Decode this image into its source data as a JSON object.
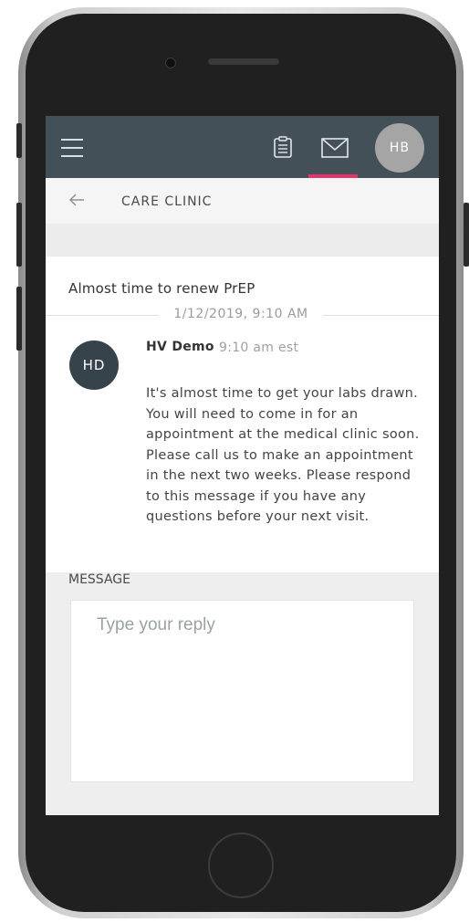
{
  "header": {
    "avatar_initials": "HB",
    "accent_color": "#e6336b",
    "bar_color": "#435058"
  },
  "subheader": {
    "title": "CARE CLINIC"
  },
  "message": {
    "subject": "Almost time to renew PrEP",
    "date": "1/12/2019, 9:10 AM",
    "sender_initials": "HD",
    "sender_name": "HV Demo",
    "sent_time": "9:10 am est",
    "body": "It's almost time to get your labs drawn. You will need to come in for an appointment at the medical clinic soon. Please call us to make an appointment in the next two weeks. Please respond to this message if you have any questions before your next visit."
  },
  "reply": {
    "label": "MESSAGE",
    "placeholder": "Type your reply",
    "value": ""
  },
  "icons": {
    "menu": "hamburger-menu-icon",
    "clipboard": "clipboard-icon",
    "mail": "mail-icon",
    "back": "arrow-left-icon"
  }
}
